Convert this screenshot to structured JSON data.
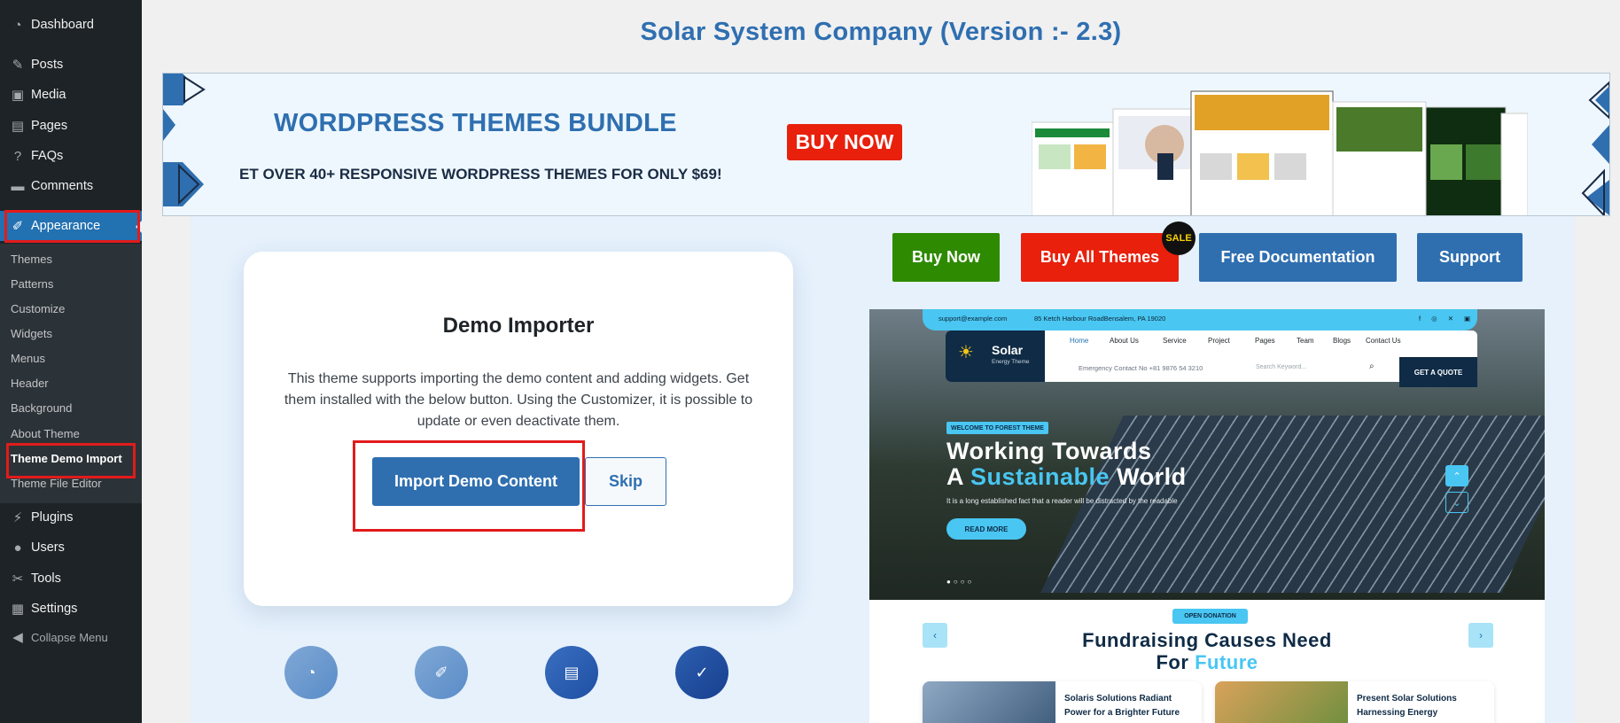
{
  "sidebar": {
    "items_top": [
      {
        "label": "Dashboard",
        "icon": "dashboard-icon"
      },
      {
        "label": "Posts",
        "icon": "pin-icon"
      },
      {
        "label": "Media",
        "icon": "media-icon"
      },
      {
        "label": "Pages",
        "icon": "pages-icon"
      },
      {
        "label": "FAQs",
        "icon": "question-icon"
      },
      {
        "label": "Comments",
        "icon": "comment-icon"
      },
      {
        "label": "Appearance",
        "icon": "brush-icon"
      }
    ],
    "submenu": [
      "Themes",
      "Patterns",
      "Customize",
      "Widgets",
      "Menus",
      "Header",
      "Background",
      "About Theme",
      "Theme Demo Import",
      "Theme File Editor"
    ],
    "items_bottom": [
      {
        "label": "Plugins",
        "icon": "plugin-icon"
      },
      {
        "label": "Users",
        "icon": "user-icon"
      },
      {
        "label": "Tools",
        "icon": "wrench-icon"
      },
      {
        "label": "Settings",
        "icon": "settings-icon"
      },
      {
        "label": "Collapse Menu",
        "icon": "collapse-icon"
      }
    ]
  },
  "page": {
    "title": "Solar System Company (Version :- 2.3)"
  },
  "banner": {
    "heading": "WORDPRESS THEMES BUNDLE",
    "subheading": "ET OVER 40+ RESPONSIVE WORDPRESS THEMES FOR ONLY $69!",
    "buy_label": "BUY NOW"
  },
  "actions": {
    "buy_now": "Buy Now",
    "buy_all": "Buy All Themes",
    "sale_badge": "SALE",
    "docs": "Free Documentation",
    "support": "Support"
  },
  "importer": {
    "title": "Demo Importer",
    "description": "This theme supports importing the demo content and adding widgets. Get them installed with the below button. Using the Customizer, it is possible to update or even deactivate them.",
    "import_label": "Import Demo Content",
    "skip_label": "Skip"
  },
  "preview": {
    "email": "support@example.com",
    "address": "85 Ketch Harbour RoadBensalem, PA 19020",
    "logo": "Solar",
    "logo_tag": "Energy Theme",
    "nav": [
      "Home",
      "About Us",
      "Service",
      "Project",
      "Pages",
      "Team",
      "Blogs",
      "Contact Us"
    ],
    "contact": "Emergency Contact No +81 9876 54 3210",
    "search_placeholder": "Search Keyword...",
    "quote": "GET A QUOTE",
    "welcome": "WELCOME TO FOREST THEME",
    "hero_line1": "Working Towards",
    "hero_a": "A",
    "hero_highlight": "Sustainable",
    "hero_world": "World",
    "hero_text": "It is a long established fact that a reader will be distracted by the readable",
    "read_more": "READ MORE",
    "donation": "OPEN DONATION",
    "section_title": "Fundraising Causes Need",
    "section_for": "For",
    "section_highlight": "Future",
    "cause1": "Solaris Solutions Radiant Power for a Brighter Future",
    "cause2": "Present Solar Solutions Harnessing Energy"
  },
  "colors": {
    "accent": "#2f6fb0",
    "wp_blue": "#2271b1",
    "red": "#e8200c",
    "green": "#2e8a00",
    "cyan": "#49c6f2"
  }
}
